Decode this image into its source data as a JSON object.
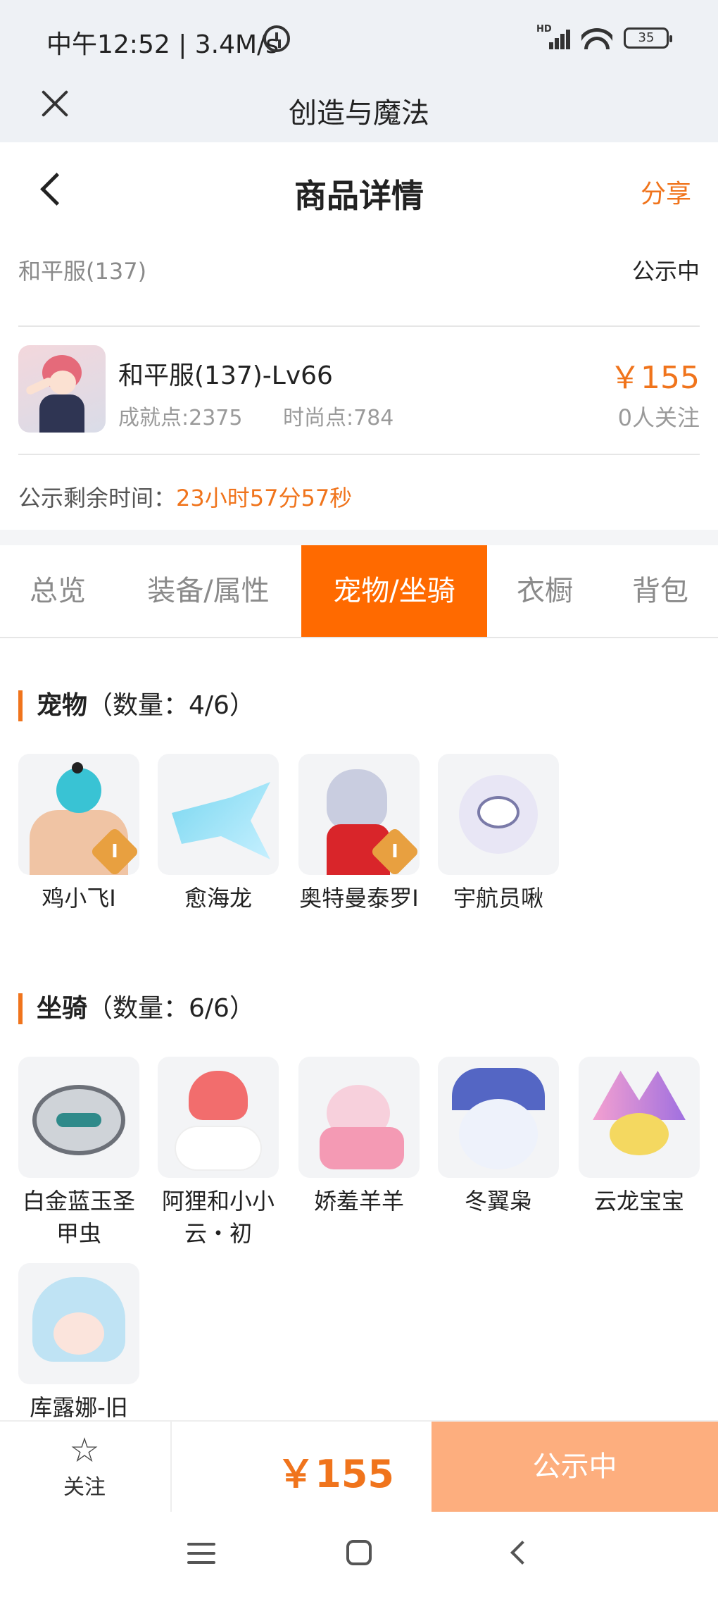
{
  "status_bar": {
    "time": "中午12:52 | 3.4M/s",
    "network": "HD",
    "battery": "35"
  },
  "app_bar": {
    "title": "创造与魔法"
  },
  "nav": {
    "title": "商品详情",
    "share": "分享"
  },
  "server": {
    "name": "和平服(137)",
    "status": "公示中"
  },
  "item": {
    "name": "和平服(137)-Lv66",
    "achievement": "成就点:2375",
    "fashion": "时尚点:784",
    "price": "￥155",
    "followers": "0人关注"
  },
  "countdown": {
    "label": "公示剩余时间：",
    "value": "23小时57分57秒"
  },
  "tabs": [
    {
      "label": "总览",
      "active": false
    },
    {
      "label": "装备/属性",
      "active": false
    },
    {
      "label": "宠物/坐骑",
      "active": true
    },
    {
      "label": "衣橱",
      "active": false
    },
    {
      "label": "背包",
      "active": false
    }
  ],
  "pets": {
    "title": "宠物",
    "count": "（数量：4/6）",
    "items": [
      {
        "name": "鸡小飞I",
        "badge": "I"
      },
      {
        "name": "愈海龙"
      },
      {
        "name": "奥特曼泰罗I",
        "badge": "I"
      },
      {
        "name": "宇航员啾"
      }
    ]
  },
  "mounts": {
    "title": "坐骑",
    "count": "（数量：6/6）",
    "items": [
      {
        "name": "白金蓝玉圣甲虫"
      },
      {
        "name": "阿狸和小小云・初"
      },
      {
        "name": "娇羞羊羊"
      },
      {
        "name": "冬翼枭"
      },
      {
        "name": "云龙宝宝"
      },
      {
        "name": "库露娜-旧"
      }
    ]
  },
  "bottom_bar": {
    "follow": "关注",
    "price": "￥155",
    "status": "公示中"
  },
  "colors": {
    "accent": "#ff6a00",
    "price": "#f0741c",
    "status_button": "#fdae7e"
  }
}
